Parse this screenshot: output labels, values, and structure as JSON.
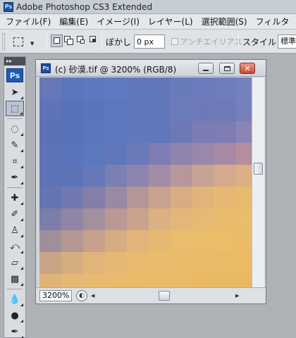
{
  "app": {
    "icon_text": "Ps",
    "title": "Adobe Photoshop CS3 Extended"
  },
  "menu": [
    "ファイル(F)",
    "編集(E)",
    "イメージ(I)",
    "レイヤー(L)",
    "選択範囲(S)",
    "フィルタ"
  ],
  "options": {
    "feather_label": "ぼかし :",
    "feather_value": "0 px",
    "antialias_label": "アンチエイリアス",
    "antialias_checked": false,
    "style_label": "スタイル :",
    "style_value": "標準"
  },
  "toolbox": {
    "header_glyph": "▸▸",
    "logo": "Ps",
    "tools": [
      {
        "name": "move-tool",
        "glyph": "➤",
        "icon": "move-icon",
        "active": false
      },
      {
        "name": "rect-marquee-tool",
        "glyph": "⬚",
        "icon": "marquee-icon",
        "active": true
      },
      {
        "name": "lasso-tool",
        "glyph": "◌",
        "icon": "lasso-icon",
        "active": false
      },
      {
        "name": "quick-select-tool",
        "glyph": "✎",
        "icon": "quick-select-icon",
        "active": false
      },
      {
        "name": "crop-tool",
        "glyph": "⌗",
        "icon": "crop-icon",
        "active": false
      },
      {
        "name": "slice-tool",
        "glyph": "✒",
        "icon": "slice-icon",
        "active": false
      },
      {
        "name": "healing-brush-tool",
        "glyph": "✚",
        "icon": "bandage-icon",
        "active": false
      },
      {
        "name": "brush-tool",
        "glyph": "✐",
        "icon": "brush-icon",
        "active": false
      },
      {
        "name": "clone-stamp-tool",
        "glyph": "♙",
        "icon": "stamp-icon",
        "active": false
      },
      {
        "name": "history-brush-tool",
        "glyph": "⤺",
        "icon": "history-brush-icon",
        "active": false
      },
      {
        "name": "eraser-tool",
        "glyph": "▱",
        "icon": "eraser-icon",
        "active": false
      },
      {
        "name": "gradient-tool",
        "glyph": "▩",
        "icon": "gradient-icon",
        "active": false
      },
      {
        "name": "blur-tool",
        "glyph": "💧",
        "icon": "drop-icon",
        "active": false
      },
      {
        "name": "dodge-tool",
        "glyph": "●",
        "icon": "dodge-icon",
        "active": false
      },
      {
        "name": "pen-tool",
        "glyph": "✒",
        "icon": "pen-icon",
        "active": false
      }
    ]
  },
  "document": {
    "icon_text": "Ps",
    "title": "(c) 砂漠.tif @ 3200% (RGB/8)",
    "zoom": "3200%",
    "pixels": [
      [
        "#6877b8",
        "#5a77be",
        "#5d7ac0",
        "#5e7ac0",
        "#6078be",
        "#6277bc",
        "#6a7bbc",
        "#6d7bbd",
        "#6f7cbd",
        "#7481bf"
      ],
      [
        "#5f74b8",
        "#5872bc",
        "#5a75bd",
        "#5c78bf",
        "#6079be",
        "#6178bd",
        "#6c7bbb",
        "#7079b8",
        "#6f7ab8",
        "#757fbb"
      ],
      [
        "#5b71b7",
        "#5672bb",
        "#5a76bd",
        "#5d78be",
        "#6078bd",
        "#6377bb",
        "#6f78b6",
        "#7b7cb4",
        "#7e7db2",
        "#8b85b5"
      ],
      [
        "#5d72b8",
        "#5a75be",
        "#5c78bf",
        "#6077bc",
        "#6a79b9",
        "#7d7db3",
        "#8e84ae",
        "#9a87a9",
        "#a889a3",
        "#b48f9e"
      ],
      [
        "#5e73b7",
        "#5e74b8",
        "#6678b7",
        "#7a7fb4",
        "#8c84ad",
        "#a28da6",
        "#b7979d",
        "#c8a295",
        "#d4aa8e",
        "#dcb086"
      ],
      [
        "#6575b4",
        "#7179b0",
        "#837fa9",
        "#9989a3",
        "#b49699",
        "#c9a290",
        "#d8ad84",
        "#e1b57a",
        "#e6b873",
        "#e8ba6e"
      ],
      [
        "#7b7ea9",
        "#8e86a4",
        "#a3909e",
        "#b99896",
        "#cba38c",
        "#dbb082",
        "#e3b778",
        "#e7ba72",
        "#e9bc6d",
        "#eabd6a"
      ],
      [
        "#a08f9a",
        "#b49792",
        "#c7a18a",
        "#d6ad82",
        "#e0b47a",
        "#e6b973",
        "#e9bc6e",
        "#eabd6b",
        "#ebbd69",
        "#ebbc67"
      ],
      [
        "#c9a586",
        "#d5ae7f",
        "#dfb579",
        "#e5b974",
        "#e8bb70",
        "#e9bc6d",
        "#eabc6a",
        "#eabb68",
        "#eabb66",
        "#eaba65"
      ],
      [
        "#e0b477",
        "#e5b873",
        "#e8ba70",
        "#e9bb6d",
        "#e9bb6b",
        "#e9bb69",
        "#e9ba67",
        "#e9b966",
        "#e8b965",
        "#e8b864"
      ]
    ]
  }
}
